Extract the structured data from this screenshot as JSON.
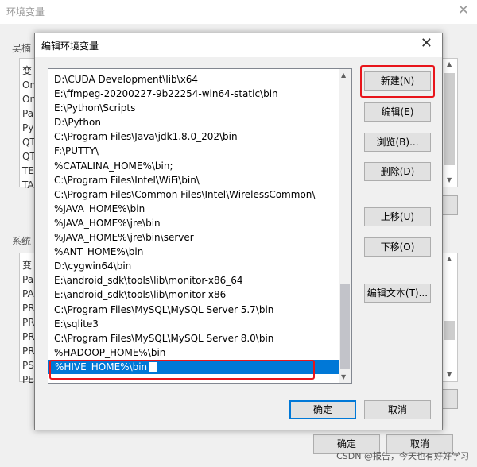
{
  "background_window": {
    "title": "环境变量",
    "user_group_label": "吴楠",
    "user_rows": [
      "变",
      "On",
      "On",
      "Pa",
      "Py",
      "QT",
      "QT",
      "TE",
      "TA"
    ],
    "system_group_label": "系统",
    "system_rows": [
      "变",
      "Pa",
      "PA",
      "PR",
      "PR",
      "PR",
      "PR",
      "PS",
      "PE"
    ],
    "ok_label": "确定",
    "cancel_label": "取消"
  },
  "dialog": {
    "title": "编辑环境变量",
    "paths": [
      "D:\\CUDA Development\\lib\\x64",
      "E:\\ffmpeg-20200227-9b22254-win64-static\\bin",
      "E:\\Python\\Scripts",
      "D:\\Python",
      "C:\\Program Files\\Java\\jdk1.8.0_202\\bin",
      "F:\\PUTTY\\",
      "%CATALINA_HOME%\\bin;",
      "C:\\Program Files\\Intel\\WiFi\\bin\\",
      "C:\\Program Files\\Common Files\\Intel\\WirelessCommon\\",
      "%JAVA_HOME%\\bin",
      "%JAVA_HOME%\\jre\\bin",
      "%JAVA_HOME%\\jre\\bin\\server",
      "%ANT_HOME%\\bin",
      "D:\\cygwin64\\bin",
      "E:\\android_sdk\\tools\\lib\\monitor-x86_64",
      "E:\\android_sdk\\tools\\lib\\monitor-x86",
      "C:\\Program Files\\MySQL\\MySQL Server 5.7\\bin",
      "E:\\sqlite3",
      "C:\\Program Files\\MySQL\\MySQL Server 8.0\\bin",
      "%HADOOP_HOME%\\bin"
    ],
    "editing_value": "%HIVE_HOME%\\bin",
    "buttons": {
      "new": "新建(N)",
      "edit": "编辑(E)",
      "browse": "浏览(B)...",
      "delete": "删除(D)",
      "move_up": "上移(U)",
      "move_down": "下移(O)",
      "edit_text": "编辑文本(T)...",
      "ok": "确定",
      "cancel": "取消"
    }
  },
  "watermark": "CSDN @报告，今天也有好好学习",
  "colors": {
    "highlight": "#e8151b",
    "selection": "#0078d7"
  }
}
